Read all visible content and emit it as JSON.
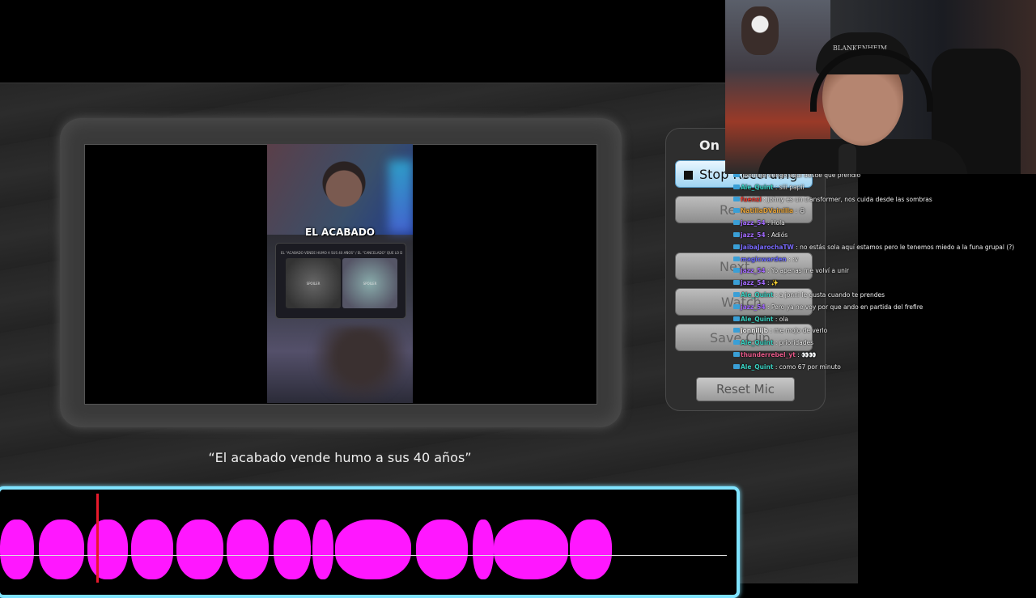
{
  "video": {
    "caption": "EL ACABADO",
    "tweet_text": "EL \"ACABADO VENDE HUMO A SUS 40 AÑOS\" / EL \"CANCELADO\" QUE LO DA",
    "spoiler_1": "SPOILER",
    "spoiler_2": "SPOILER"
  },
  "subtitle": "“El acabado vende humo a sus 40 años”",
  "panel": {
    "title": "On",
    "stop_label": "Stop Recording",
    "record_label": "Re",
    "next_label": "Next",
    "watch_label": "Watch",
    "save_label": "Save Clip",
    "reset_label": "Reset Mic"
  },
  "webcam": {
    "cap_text": "BLANKENHEIM"
  },
  "chat": [
    {
      "user": "",
      "user_color": "#9a9aff",
      "message": "jonnilijb vengo aquí desde que prendio"
    },
    {
      "user": "Ale_Quint",
      "user_color": "#3ad0c0",
      "message": ": siii papii"
    },
    {
      "user": "fuenzi",
      "user_color": "#e8382f",
      "message": ": johny es un transformer, nos cuida desde las sombras"
    },
    {
      "user": "NatillaDVainilla",
      "user_color": "#e8a53a",
      "message": ": 😃"
    },
    {
      "user": "jazz_54",
      "user_color": "#a36bff",
      "message": ": Hola"
    },
    {
      "user": "jazz_54",
      "user_color": "#a36bff",
      "message": ": Adiós"
    },
    {
      "user": "JaibaJarochaTW",
      "user_color": "#7a6bff",
      "message": ": no estás sola aquí estamos pero le tenemos miedo a la funa grupal (?)"
    },
    {
      "user": "magicwarden",
      "user_color": "#6b6bff",
      "message": ": :v"
    },
    {
      "user": "jazz_54",
      "user_color": "#a36bff",
      "message": ": Yo apenas me volví a unir"
    },
    {
      "user": "jazz_54",
      "user_color": "#a36bff",
      "message": ": ✨"
    },
    {
      "user": "Ale_Quint",
      "user_color": "#3ad0c0",
      "message": ": a jonni le gusta cuando te prendes"
    },
    {
      "user": "jazz_54",
      "user_color": "#a36bff",
      "message": ": Pero ya ne voy por que ando en partida del frefire"
    },
    {
      "user": "Ale_Quint",
      "user_color": "#3ad0c0",
      "message": ": ola"
    },
    {
      "user": "jonnilijb",
      "user_color": "#f0f0f0",
      "message": ": me mojo de verlo"
    },
    {
      "user": "Ale_Quint",
      "user_color": "#3ad0c0",
      "message": ": prioridades"
    },
    {
      "user": "thunderrebel_yt",
      "user_color": "#e85a8a",
      "message": ": 👀👀"
    },
    {
      "user": "Ale_Quint",
      "user_color": "#3ad0c0",
      "message": ": como 67 por minuto"
    }
  ],
  "colors": {
    "timeline_border": "#7fe3ff",
    "waveform": "#ff17ff",
    "playhead": "#e81a2c"
  }
}
